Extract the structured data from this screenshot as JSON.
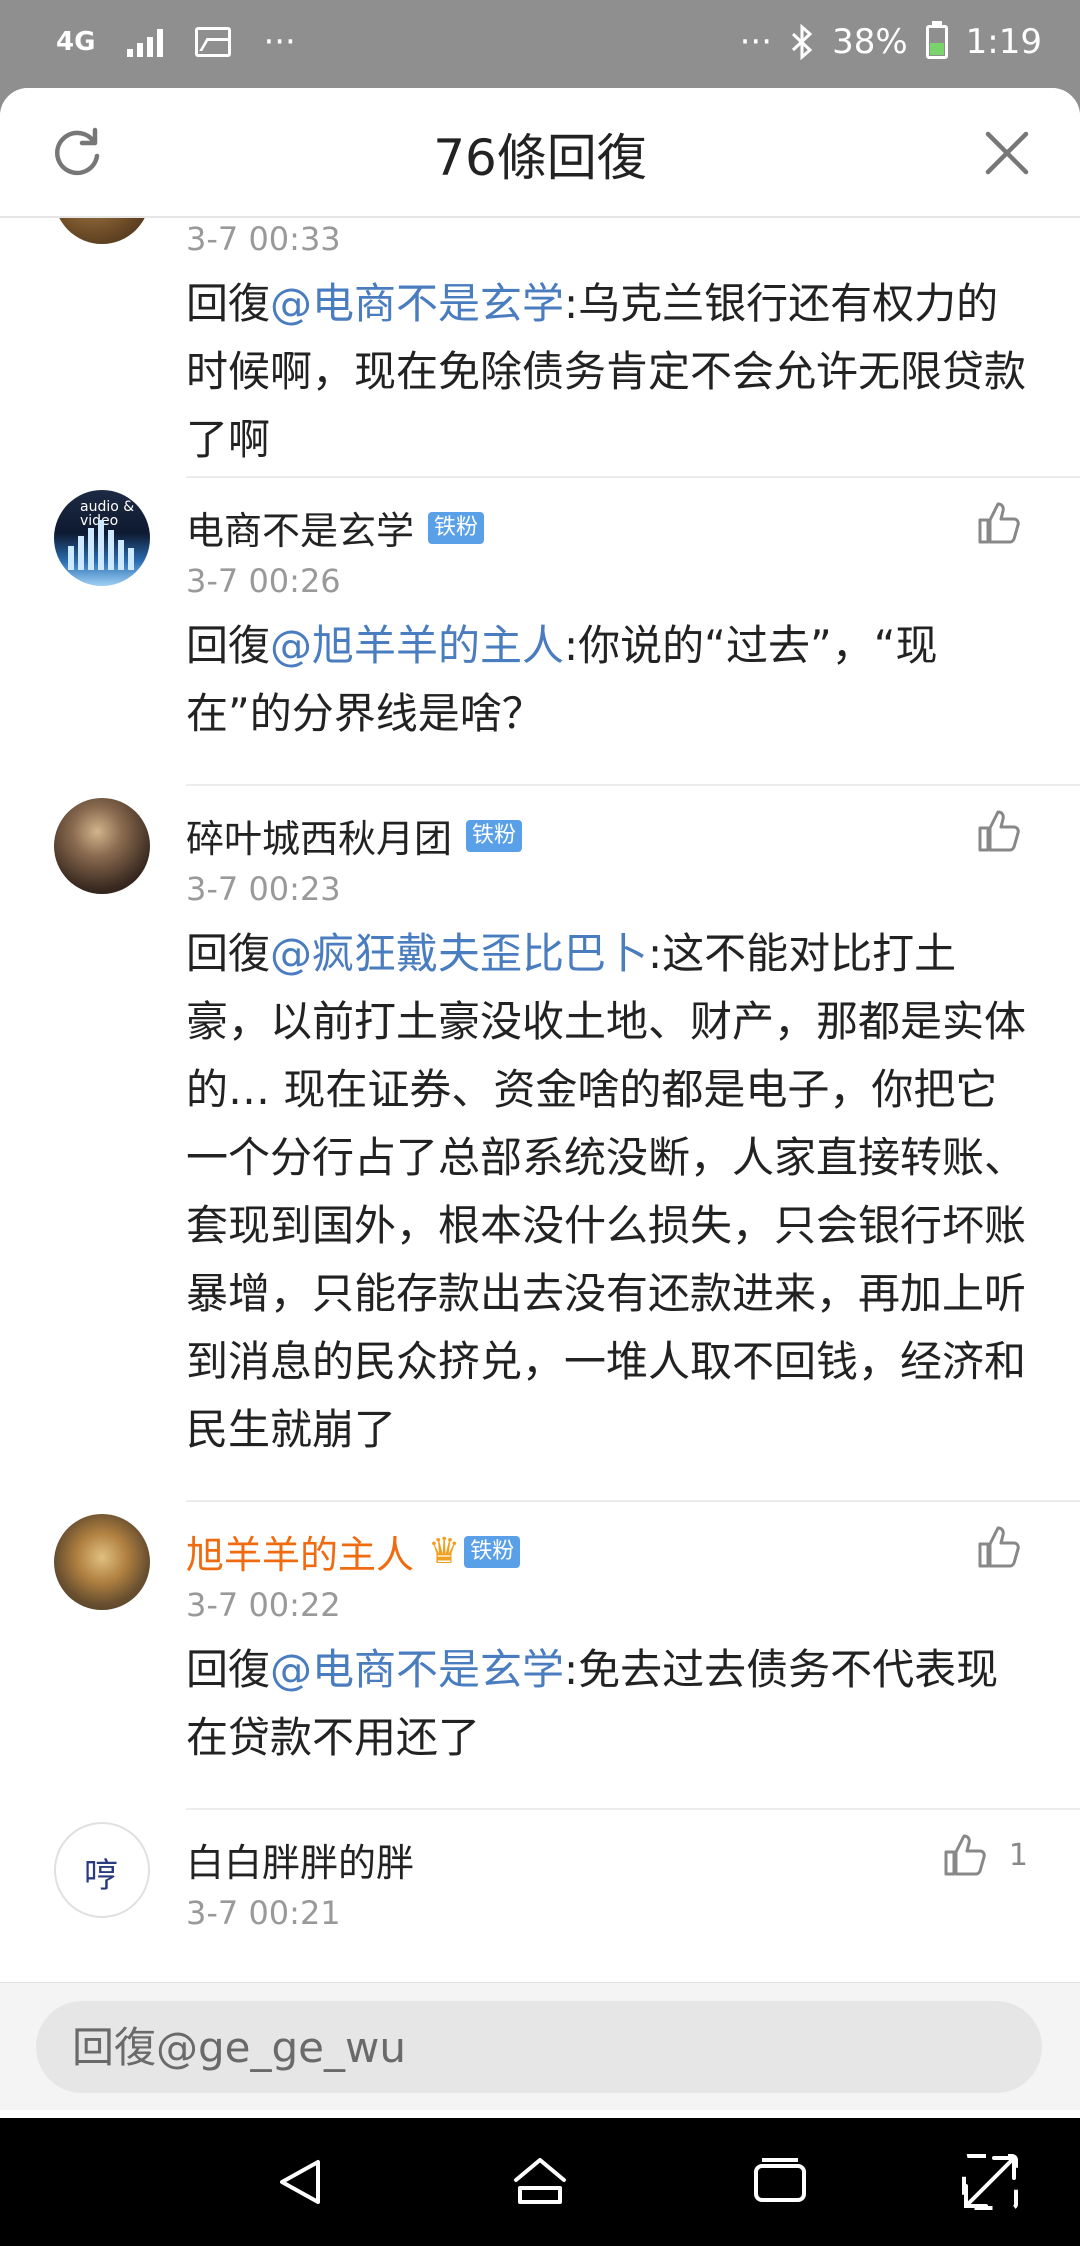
{
  "status_bar": {
    "network": "4G",
    "more": "···",
    "more_right": "···",
    "battery_pct": "38%",
    "time": "1:19"
  },
  "header": {
    "title": "76條回復"
  },
  "comments": [
    {
      "name": "",
      "time": "3-7 00:33",
      "reply_prefix": "回復",
      "mention": "@电商不是玄学",
      "body": ":乌克兰银行还有权力的时候啊，现在免除债务肯定不会允许无限贷款了啊"
    },
    {
      "name": "电商不是玄学",
      "badge": "铁粉",
      "time": "3-7 00:26",
      "reply_prefix": "回復",
      "mention": "@旭羊羊的主人",
      "body": ":你说的“过去”，“现在”的分界线是啥？",
      "avatar_text": "audio & video"
    },
    {
      "name": "碎叶城西秋月团",
      "badge": "铁粉",
      "time": "3-7 00:23",
      "reply_prefix": "回復",
      "mention": "@疯狂戴夫歪比巴卜",
      "body": ":这不能对比打土豪，以前打土豪没收土地、财产，那都是实体的… 现在证券、资金啥的都是电子，你把它一个分行占了总部系统没断，人家直接转账、套现到国外，根本没什么损失，只会银行坏账暴增，只能存款出去没有还款进来，再加上听到消息的民众挤兑，一堆人取不回钱，经济和民生就崩了"
    },
    {
      "name": "旭羊羊的主人",
      "badge": "铁粉",
      "time": "3-7 00:22",
      "reply_prefix": "回復",
      "mention": "@电商不是玄学",
      "body": ":免去过去债务不代表现在贷款不用还了"
    },
    {
      "name": "白白胖胖的胖",
      "time": "3-7 00:21",
      "likes": "1",
      "avatar_text": "哼"
    }
  ],
  "reply_bar": {
    "placeholder": "回復@ge_ge_wu"
  },
  "colors": {
    "mention": "#4a7cc0",
    "vip_name": "#f06a0f",
    "badge": "#5aa0e8"
  },
  "icons": [
    "refresh-icon",
    "close-icon",
    "thumbs-up-icon",
    "back-icon",
    "home-icon",
    "recents-icon",
    "expand-icon"
  ]
}
